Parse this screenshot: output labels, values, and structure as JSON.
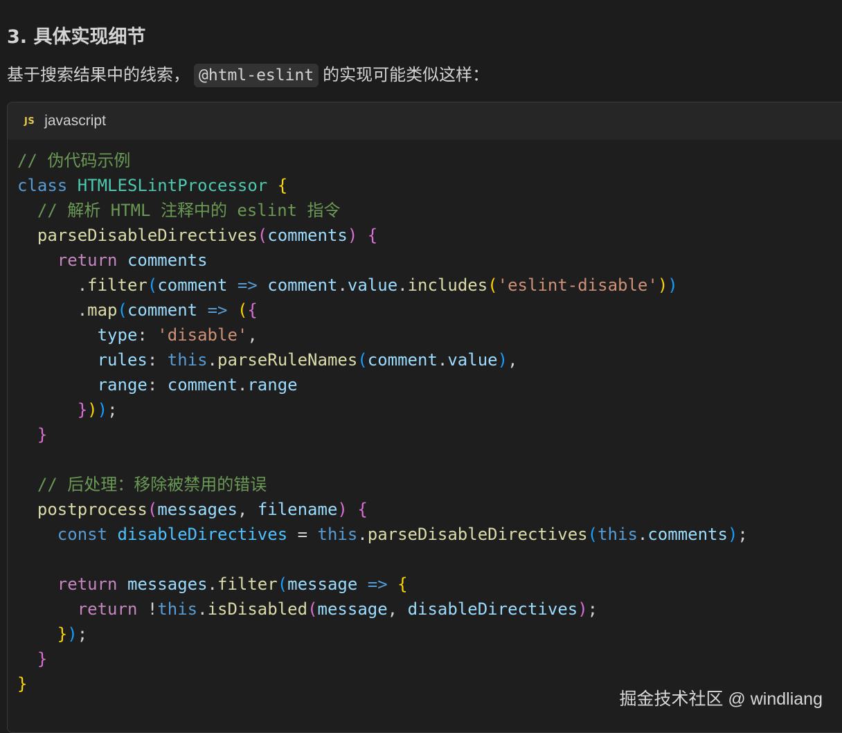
{
  "heading": "3. 具体实现细节",
  "intro": {
    "prefix": "基于搜索结果中的线索，",
    "code": "@html-eslint",
    "suffix": "的实现可能类似这样："
  },
  "code_block": {
    "language_icon": "JS",
    "language": "javascript",
    "lines": [
      [
        [
          "// 伪代码示例",
          "#6a9955"
        ]
      ],
      [
        [
          "class",
          "#569cd6"
        ],
        [
          " ",
          "#d4d4d4"
        ],
        [
          "HTMLESLintProcessor",
          "#4ec9b0"
        ],
        [
          " ",
          "#d4d4d4"
        ],
        [
          "{",
          "#ffd700"
        ]
      ],
      [
        [
          "  ",
          "#d4d4d4"
        ],
        [
          "// 解析 HTML 注释中的 eslint 指令",
          "#6a9955"
        ]
      ],
      [
        [
          "  ",
          "#d4d4d4"
        ],
        [
          "parseDisableDirectives",
          "#dcdcaa"
        ],
        [
          "(",
          "#da70d6"
        ],
        [
          "comments",
          "#9cdcfe"
        ],
        [
          ")",
          "#da70d6"
        ],
        [
          " ",
          "#d4d4d4"
        ],
        [
          "{",
          "#da70d6"
        ]
      ],
      [
        [
          "    ",
          "#d4d4d4"
        ],
        [
          "return",
          "#c586c0"
        ],
        [
          " ",
          "#d4d4d4"
        ],
        [
          "comments",
          "#9cdcfe"
        ]
      ],
      [
        [
          "      .",
          "#d4d4d4"
        ],
        [
          "filter",
          "#dcdcaa"
        ],
        [
          "(",
          "#179fff"
        ],
        [
          "comment",
          "#9cdcfe"
        ],
        [
          " ",
          "#d4d4d4"
        ],
        [
          "=>",
          "#569cd6"
        ],
        [
          " ",
          "#d4d4d4"
        ],
        [
          "comment",
          "#9cdcfe"
        ],
        [
          ".",
          "#d4d4d4"
        ],
        [
          "value",
          "#9cdcfe"
        ],
        [
          ".",
          "#d4d4d4"
        ],
        [
          "includes",
          "#dcdcaa"
        ],
        [
          "(",
          "#ffd700"
        ],
        [
          "'eslint-disable'",
          "#ce9178"
        ],
        [
          ")",
          "#ffd700"
        ],
        [
          ")",
          "#179fff"
        ]
      ],
      [
        [
          "      .",
          "#d4d4d4"
        ],
        [
          "map",
          "#dcdcaa"
        ],
        [
          "(",
          "#179fff"
        ],
        [
          "comment",
          "#9cdcfe"
        ],
        [
          " ",
          "#d4d4d4"
        ],
        [
          "=>",
          "#569cd6"
        ],
        [
          " ",
          "#d4d4d4"
        ],
        [
          "(",
          "#ffd700"
        ],
        [
          "{",
          "#da70d6"
        ]
      ],
      [
        [
          "        ",
          "#d4d4d4"
        ],
        [
          "type",
          "#9cdcfe"
        ],
        [
          ": ",
          "#d4d4d4"
        ],
        [
          "'disable'",
          "#ce9178"
        ],
        [
          ",",
          "#d4d4d4"
        ]
      ],
      [
        [
          "        ",
          "#d4d4d4"
        ],
        [
          "rules",
          "#9cdcfe"
        ],
        [
          ": ",
          "#d4d4d4"
        ],
        [
          "this",
          "#569cd6"
        ],
        [
          ".",
          "#d4d4d4"
        ],
        [
          "parseRuleNames",
          "#dcdcaa"
        ],
        [
          "(",
          "#179fff"
        ],
        [
          "comment",
          "#9cdcfe"
        ],
        [
          ".",
          "#d4d4d4"
        ],
        [
          "value",
          "#9cdcfe"
        ],
        [
          ")",
          "#179fff"
        ],
        [
          ",",
          "#d4d4d4"
        ]
      ],
      [
        [
          "        ",
          "#d4d4d4"
        ],
        [
          "range",
          "#9cdcfe"
        ],
        [
          ": ",
          "#d4d4d4"
        ],
        [
          "comment",
          "#9cdcfe"
        ],
        [
          ".",
          "#d4d4d4"
        ],
        [
          "range",
          "#9cdcfe"
        ]
      ],
      [
        [
          "      ",
          "#d4d4d4"
        ],
        [
          "}",
          "#da70d6"
        ],
        [
          ")",
          "#ffd700"
        ],
        [
          ")",
          "#179fff"
        ],
        [
          ";",
          "#d4d4d4"
        ]
      ],
      [
        [
          "  ",
          "#d4d4d4"
        ],
        [
          "}",
          "#da70d6"
        ]
      ],
      [
        [
          "",
          "#d4d4d4"
        ]
      ],
      [
        [
          "  ",
          "#d4d4d4"
        ],
        [
          "// 后处理：移除被禁用的错误",
          "#6a9955"
        ]
      ],
      [
        [
          "  ",
          "#d4d4d4"
        ],
        [
          "postprocess",
          "#dcdcaa"
        ],
        [
          "(",
          "#da70d6"
        ],
        [
          "messages",
          "#9cdcfe"
        ],
        [
          ", ",
          "#d4d4d4"
        ],
        [
          "filename",
          "#9cdcfe"
        ],
        [
          ")",
          "#da70d6"
        ],
        [
          " ",
          "#d4d4d4"
        ],
        [
          "{",
          "#da70d6"
        ]
      ],
      [
        [
          "    ",
          "#d4d4d4"
        ],
        [
          "const",
          "#569cd6"
        ],
        [
          " ",
          "#d4d4d4"
        ],
        [
          "disableDirectives",
          "#4fc1ff"
        ],
        [
          " = ",
          "#d4d4d4"
        ],
        [
          "this",
          "#569cd6"
        ],
        [
          ".",
          "#d4d4d4"
        ],
        [
          "parseDisableDirectives",
          "#dcdcaa"
        ],
        [
          "(",
          "#179fff"
        ],
        [
          "this",
          "#569cd6"
        ],
        [
          ".",
          "#d4d4d4"
        ],
        [
          "comments",
          "#9cdcfe"
        ],
        [
          ")",
          "#179fff"
        ],
        [
          ";",
          "#d4d4d4"
        ]
      ],
      [
        [
          "",
          "#d4d4d4"
        ]
      ],
      [
        [
          "    ",
          "#d4d4d4"
        ],
        [
          "return",
          "#c586c0"
        ],
        [
          " ",
          "#d4d4d4"
        ],
        [
          "messages",
          "#9cdcfe"
        ],
        [
          ".",
          "#d4d4d4"
        ],
        [
          "filter",
          "#dcdcaa"
        ],
        [
          "(",
          "#179fff"
        ],
        [
          "message",
          "#9cdcfe"
        ],
        [
          " ",
          "#d4d4d4"
        ],
        [
          "=>",
          "#569cd6"
        ],
        [
          " ",
          "#d4d4d4"
        ],
        [
          "{",
          "#ffd700"
        ]
      ],
      [
        [
          "      ",
          "#d4d4d4"
        ],
        [
          "return",
          "#c586c0"
        ],
        [
          " !",
          "#d4d4d4"
        ],
        [
          "this",
          "#569cd6"
        ],
        [
          ".",
          "#d4d4d4"
        ],
        [
          "isDisabled",
          "#dcdcaa"
        ],
        [
          "(",
          "#da70d6"
        ],
        [
          "message",
          "#9cdcfe"
        ],
        [
          ", ",
          "#d4d4d4"
        ],
        [
          "disableDirectives",
          "#9cdcfe"
        ],
        [
          ")",
          "#da70d6"
        ],
        [
          ";",
          "#d4d4d4"
        ]
      ],
      [
        [
          "    ",
          "#d4d4d4"
        ],
        [
          "}",
          "#ffd700"
        ],
        [
          ")",
          "#179fff"
        ],
        [
          ";",
          "#d4d4d4"
        ]
      ],
      [
        [
          "  ",
          "#d4d4d4"
        ],
        [
          "}",
          "#da70d6"
        ]
      ],
      [
        [
          "}",
          "#ffd700"
        ]
      ]
    ]
  },
  "watermark": "掘金技术社区 @ windliang"
}
